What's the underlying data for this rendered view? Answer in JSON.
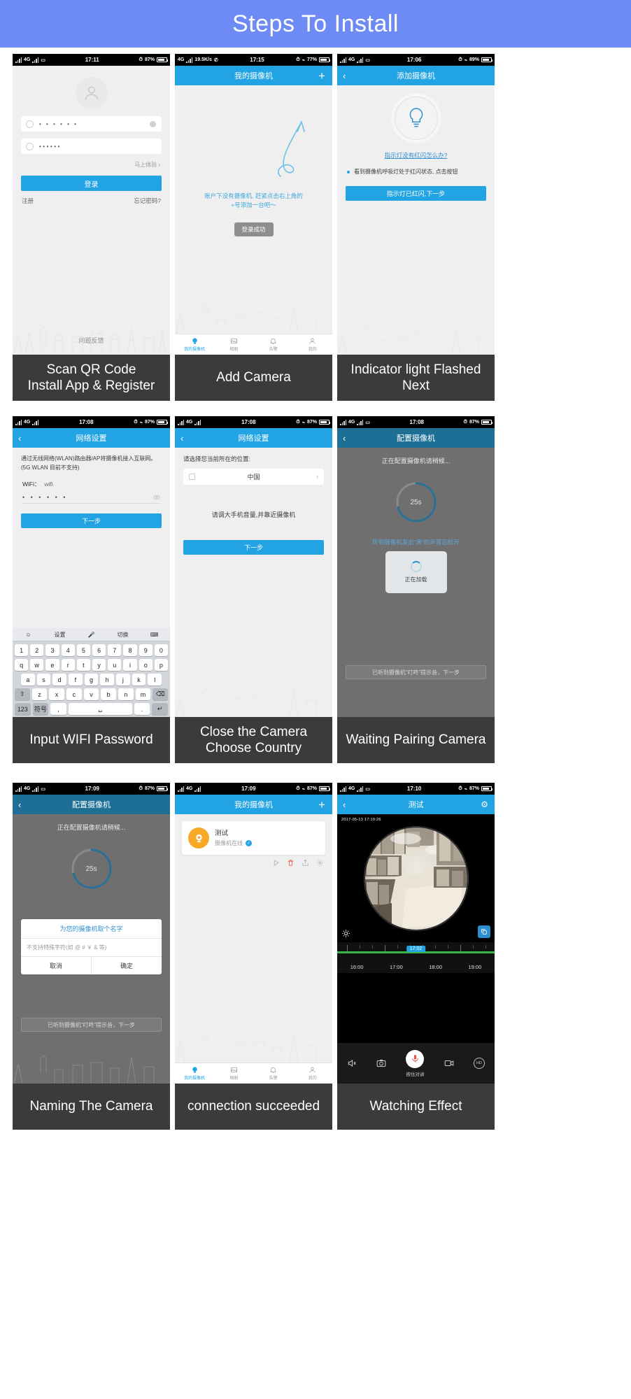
{
  "banner": {
    "title": "Steps To Install"
  },
  "common": {
    "time_1711": "17:11",
    "time_1715": "17:15",
    "time_1706": "17:06",
    "time_1708": "17:08",
    "time_1709": "17:09",
    "time_1710": "17:10",
    "battery_87": "87%",
    "battery_77": "77%",
    "battery_89": "89%",
    "netspeed": "19.5K/s",
    "net_4g": "4G",
    "plus": "+",
    "back": "‹",
    "chevron": "›"
  },
  "tabbar": {
    "items": [
      {
        "label": "我的摄像机",
        "icon": "camera-icon",
        "active": true
      },
      {
        "label": "相册",
        "icon": "album-icon",
        "active": false
      },
      {
        "label": "告警",
        "icon": "bell-icon",
        "active": false
      },
      {
        "label": "我的",
        "icon": "person-icon",
        "active": false
      }
    ]
  },
  "panels": [
    {
      "id": "login",
      "caption": [
        "Scan QR Code",
        "Install App & Register"
      ],
      "status_time": "17:11",
      "battery": "87%",
      "username_value": "• • • • • •",
      "password_value": "••••••",
      "try_now": "马上体验 ›",
      "login_button": "登录",
      "register": "注册",
      "forgot": "忘记密码?",
      "feedback": "问题反馈"
    },
    {
      "id": "empty-list",
      "caption": [
        "Add Camera"
      ],
      "status_time": "17:15",
      "netspeed": "19.5K/s",
      "battery": "77%",
      "nav_title": "我的摄像机",
      "empty_text_1": "账户下没有摄像机, 赶紧点击右上角的",
      "empty_text_2": "+号添加一台吧～",
      "toast": "登录成功"
    },
    {
      "id": "add-camera",
      "caption": [
        "Indicator light Flashed",
        "Next"
      ],
      "status_time": "17:06",
      "battery": "89%",
      "nav_title": "添加摄像机",
      "help_link": "指示灯没有红闪怎么办?",
      "bullet": "看到摄像机呼吸灯处于红闪状态, 点击按钮",
      "next_button": "指示灯已红闪,下一步"
    },
    {
      "id": "wifi",
      "caption": [
        "Input WIFI Password"
      ],
      "status_time": "17:08",
      "battery": "87%",
      "nav_title": "网络设置",
      "intro": "通过无线网络(WLAN)路由器/AP将摄像机接入互联网。(5G WLAN 目前不支持)",
      "wifi_label": "WiFi：",
      "wifi_ssid": "wifi",
      "password_value": "• • • • • •",
      "next_button": "下一步",
      "keyboard": {
        "toolbar": [
          "设置",
          "切换"
        ],
        "row_num": [
          "1",
          "2",
          "3",
          "4",
          "5",
          "6",
          "7",
          "8",
          "9",
          "0"
        ],
        "row_1": [
          "q",
          "w",
          "e",
          "r",
          "t",
          "y",
          "u",
          "i",
          "o",
          "p"
        ],
        "row_2": [
          "a",
          "s",
          "d",
          "f",
          "g",
          "h",
          "j",
          "k",
          "l"
        ],
        "row_3": [
          "⇧",
          "z",
          "x",
          "c",
          "v",
          "b",
          "n",
          "m",
          "⌫"
        ],
        "row_4": [
          "123",
          "符号",
          ",",
          "␣",
          ".",
          "↵"
        ]
      }
    },
    {
      "id": "country",
      "caption": [
        "Close the Camera",
        "Choose Country"
      ],
      "status_time": "17:08",
      "battery": "87%",
      "nav_title": "网络设置",
      "select_label": "请选择您当前所在的位置:",
      "country_value": "中国",
      "note": "请调大手机音量,并靠近摄像机",
      "next_button": "下一步"
    },
    {
      "id": "pairing",
      "caption": [
        "Waiting Pairing Camera"
      ],
      "status_time": "17:08",
      "battery": "87%",
      "nav_title": "配置摄像机",
      "configuring": "正在配置摄像机请稍候...",
      "countdown": "25s",
      "sub_text": "听到摄像机发出“滴”的声音后松开",
      "loading": "正在加载",
      "ghost_button": "已听到摄像机“叮咚”提示音，下一步"
    },
    {
      "id": "naming",
      "caption": [
        "Naming The Camera"
      ],
      "status_time": "17:09",
      "battery": "87%",
      "nav_title": "配置摄像机",
      "configuring": "正在配置摄像机请稍候...",
      "countdown": "25s",
      "dialog_title": "为您的摄像机取个名字",
      "dialog_placeholder": "不支持特殊字符(如 @ # ￥ & 等)",
      "dialog_cancel": "取消",
      "dialog_ok": "确定",
      "ghost_button": "已听到摄像机“叮咚”提示音，下一步"
    },
    {
      "id": "connected",
      "caption": [
        "connection succeeded"
      ],
      "status_time": "17:09",
      "battery": "87%",
      "nav_title": "我的摄像机",
      "camera_name": "测试",
      "camera_status": "摄像机在线"
    },
    {
      "id": "watching",
      "caption": [
        "Watching Effect"
      ],
      "status_time": "17:10",
      "battery": "87%",
      "nav_title": "测试",
      "video_timestamp": "2017-05-13 17:10:26",
      "current_time_pill": "17:02",
      "timeline_labels": [
        "16:00",
        "17:00",
        "18:00",
        "19:00"
      ],
      "talk_label": "按住对讲",
      "hd_label": "HD"
    }
  ]
}
